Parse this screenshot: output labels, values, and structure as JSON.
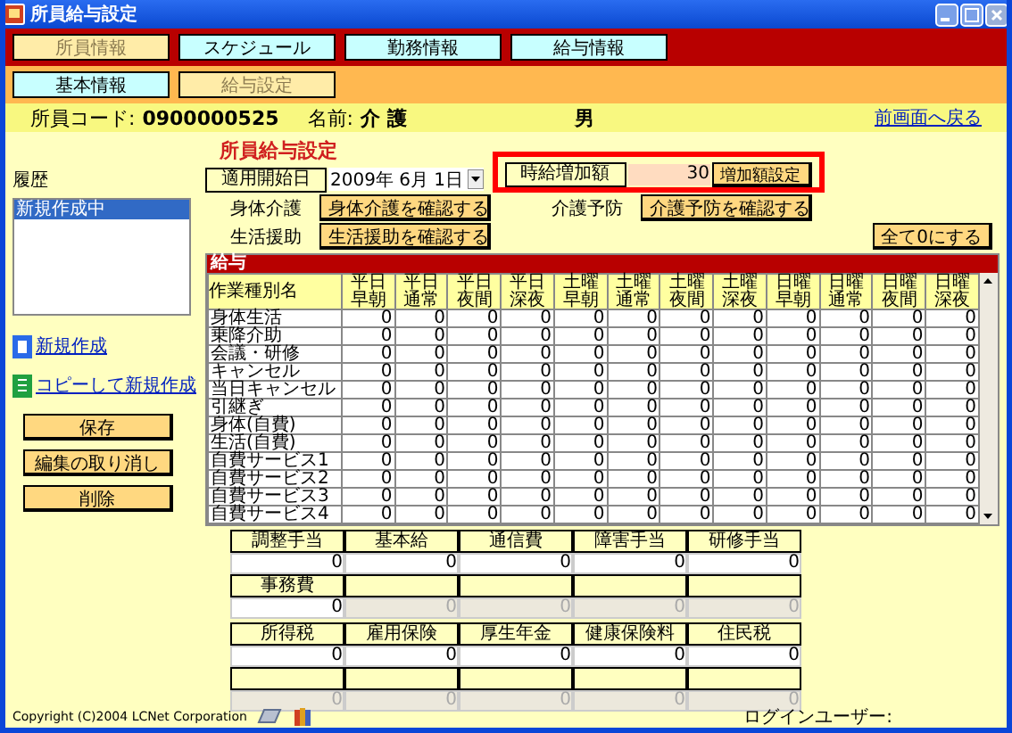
{
  "window": {
    "title": "所員給与設定"
  },
  "main_tabs": [
    {
      "label": "所員情報",
      "selected": true
    },
    {
      "label": "スケジュール",
      "selected": false
    },
    {
      "label": "勤務情報",
      "selected": false
    },
    {
      "label": "給与情報",
      "selected": false
    }
  ],
  "sub_tabs": [
    {
      "label": "基本情報",
      "selected": false
    },
    {
      "label": "給与設定",
      "selected": true
    }
  ],
  "staff_info": {
    "code_label": "所員コード:",
    "code": "0900000525",
    "name_label": "名前:",
    "name": "介 護",
    "gender": "男",
    "back_link": "前画面へ戻る"
  },
  "history": {
    "title": "履歴",
    "items": [
      {
        "label": "新規作成中",
        "selected": true
      }
    ]
  },
  "actions": [
    {
      "label": "新規作成",
      "kind": "new"
    },
    {
      "label": "コピーして新規作成",
      "kind": "copy"
    }
  ],
  "buttons": [
    "保存",
    "編集の取り消し",
    "削除"
  ],
  "section_title": "所員給与設定",
  "start_date": {
    "label": "適用開始日",
    "value": "2009年 6月 1日"
  },
  "hourly_increase": {
    "label": "時給増加額",
    "value": "30",
    "button": "増加額設定"
  },
  "confirm_rows": [
    [
      {
        "label": "身体介護",
        "button": "身体介護を確認する"
      },
      {
        "label": "介護予防",
        "button": "介護予防を確認する"
      }
    ],
    [
      {
        "label": "生活援助",
        "button": "生活援助を確認する"
      }
    ]
  ],
  "zero_button": "全て0にする",
  "salary_table": {
    "title": "給与",
    "columns": [
      "作業種別名",
      "平日早朝",
      "平日通常",
      "平日夜間",
      "平日深夜",
      "土曜早朝",
      "土曜通常",
      "土曜夜間",
      "土曜深夜",
      "日曜早朝",
      "日曜通常",
      "日曜夜間",
      "日曜深夜"
    ],
    "rows": [
      {
        "name": "身体生活",
        "values": [
          "0",
          "0",
          "0",
          "0",
          "0",
          "0",
          "0",
          "0",
          "0",
          "0",
          "0",
          "0"
        ]
      },
      {
        "name": "乗降介助",
        "values": [
          "0",
          "0",
          "0",
          "0",
          "0",
          "0",
          "0",
          "0",
          "0",
          "0",
          "0",
          "0"
        ]
      },
      {
        "name": "会議・研修",
        "values": [
          "0",
          "0",
          "0",
          "0",
          "0",
          "0",
          "0",
          "0",
          "0",
          "0",
          "0",
          "0"
        ]
      },
      {
        "name": "キャンセル",
        "values": [
          "0",
          "0",
          "0",
          "0",
          "0",
          "0",
          "0",
          "0",
          "0",
          "0",
          "0",
          "0"
        ]
      },
      {
        "name": "当日キャンセル",
        "values": [
          "0",
          "0",
          "0",
          "0",
          "0",
          "0",
          "0",
          "0",
          "0",
          "0",
          "0",
          "0"
        ]
      },
      {
        "name": "引継ぎ",
        "values": [
          "0",
          "0",
          "0",
          "0",
          "0",
          "0",
          "0",
          "0",
          "0",
          "0",
          "0",
          "0"
        ]
      },
      {
        "name": "身体(自費)",
        "values": [
          "0",
          "0",
          "0",
          "0",
          "0",
          "0",
          "0",
          "0",
          "0",
          "0",
          "0",
          "0"
        ]
      },
      {
        "name": "生活(自費)",
        "values": [
          "0",
          "0",
          "0",
          "0",
          "0",
          "0",
          "0",
          "0",
          "0",
          "0",
          "0",
          "0"
        ]
      },
      {
        "name": "自費サービス1",
        "values": [
          "0",
          "0",
          "0",
          "0",
          "0",
          "0",
          "0",
          "0",
          "0",
          "0",
          "0",
          "0"
        ]
      },
      {
        "name": "自費サービス2",
        "values": [
          "0",
          "0",
          "0",
          "0",
          "0",
          "0",
          "0",
          "0",
          "0",
          "0",
          "0",
          "0"
        ]
      },
      {
        "name": "自費サービス3",
        "values": [
          "0",
          "0",
          "0",
          "0",
          "0",
          "0",
          "0",
          "0",
          "0",
          "0",
          "0",
          "0"
        ]
      },
      {
        "name": "自費サービス4",
        "values": [
          "0",
          "0",
          "0",
          "0",
          "0",
          "0",
          "0",
          "0",
          "0",
          "0",
          "0",
          "0"
        ]
      }
    ]
  },
  "allowance_groups": [
    {
      "rows": [
        [
          {
            "label": "調整手当",
            "value": "0",
            "disabled": false
          },
          {
            "label": "基本給",
            "value": "0",
            "disabled": false
          },
          {
            "label": "通信費",
            "value": "0",
            "disabled": false
          },
          {
            "label": "障害手当",
            "value": "0",
            "disabled": false
          },
          {
            "label": "研修手当",
            "value": "0",
            "disabled": false
          }
        ],
        [
          {
            "label": "事務費",
            "value": "0",
            "disabled": false
          },
          {
            "value": "0",
            "disabled": true
          },
          {
            "value": "0",
            "disabled": true
          },
          {
            "value": "0",
            "disabled": true
          },
          {
            "value": "0",
            "disabled": true
          }
        ]
      ]
    },
    {
      "rows": [
        [
          {
            "label": "所得税",
            "value": "0",
            "disabled": false
          },
          {
            "label": "雇用保険",
            "value": "0",
            "disabled": false
          },
          {
            "label": "厚生年金",
            "value": "0",
            "disabled": false
          },
          {
            "label": "健康保険料",
            "value": "0",
            "disabled": false
          },
          {
            "label": "住民税",
            "value": "0",
            "disabled": false
          }
        ],
        [
          {
            "value": "0",
            "disabled": true
          },
          {
            "value": "0",
            "disabled": true
          },
          {
            "value": "0",
            "disabled": true
          },
          {
            "value": "0",
            "disabled": true
          },
          {
            "value": "0",
            "disabled": true
          }
        ]
      ]
    }
  ],
  "footer": {
    "copyright": "Copyright (C)2004 LCNet Corporation",
    "login_label": "ログインユーザー:"
  }
}
